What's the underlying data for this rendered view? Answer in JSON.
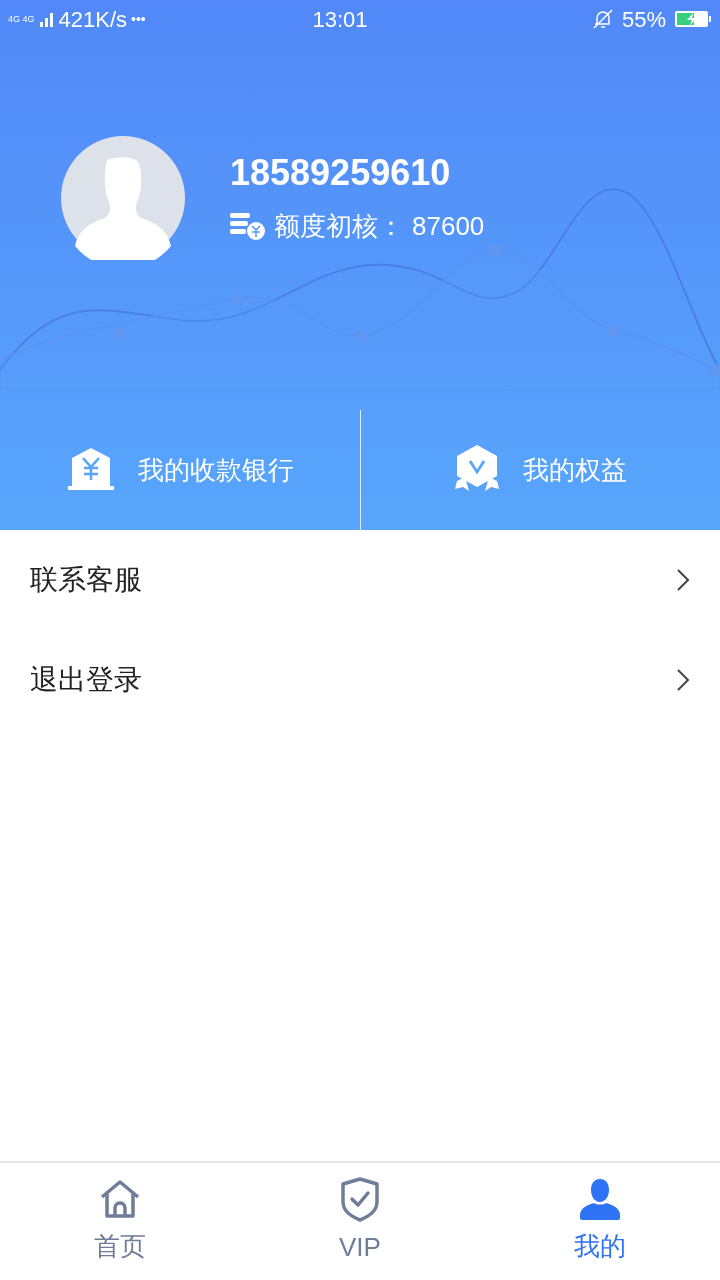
{
  "status_bar": {
    "network": "4G 4G",
    "speed": "421K/s",
    "more": "•••",
    "time": "13:01",
    "battery": "55%"
  },
  "profile": {
    "phone": "18589259610",
    "credit_label": "额度初核：",
    "credit_value": "87600"
  },
  "shortcuts": [
    {
      "kind": "bank",
      "label": "我的收款银行"
    },
    {
      "kind": "rights",
      "label": "我的权益"
    }
  ],
  "menu": [
    {
      "label": "联系客服"
    },
    {
      "label": "退出登录"
    }
  ],
  "tab_bar": [
    {
      "kind": "home",
      "label": "首页",
      "selected": false
    },
    {
      "kind": "vip",
      "label": "VIP",
      "selected": false
    },
    {
      "kind": "me",
      "label": "我的",
      "selected": true
    }
  ]
}
